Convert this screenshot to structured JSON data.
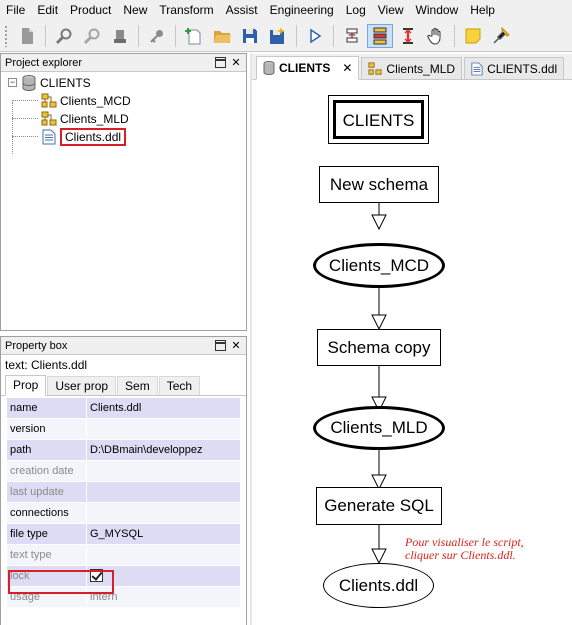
{
  "menubar": {
    "items": [
      "File",
      "Edit",
      "Product",
      "New",
      "Transform",
      "Assist",
      "Engineering",
      "Log",
      "View",
      "Window",
      "Help"
    ]
  },
  "toolbar": {
    "buttons": [
      "document-icon",
      "search-icon",
      "search-grey-icon",
      "stamp-icon",
      "key-icon",
      "new-project-icon",
      "open-folder-icon",
      "save-icon",
      "save-as-icon",
      "run-icon",
      "collapse-icon",
      "tree-icon",
      "split-icon",
      "hand-icon",
      "note-icon",
      "pin-icon"
    ]
  },
  "project_explorer": {
    "title": "Project explorer",
    "root": "CLIENTS",
    "children": [
      "Clients_MCD",
      "Clients_MLD",
      "Clients.ddl"
    ]
  },
  "property_box": {
    "title": "Property box",
    "subtitle": "text: Clients.ddl",
    "tabs": [
      "Prop",
      "User prop",
      "Sem",
      "Tech"
    ],
    "rows": [
      {
        "key": "name",
        "value": "Clients.ddl"
      },
      {
        "key": "version",
        "value": ""
      },
      {
        "key": "path",
        "value": "D:\\DBmain\\developpez"
      },
      {
        "key": "creation date",
        "value": ""
      },
      {
        "key": "last update",
        "value": ""
      },
      {
        "key": "connections",
        "value": ""
      },
      {
        "key": "file type",
        "value": "G_MYSQL"
      },
      {
        "key": "text type",
        "value": ""
      },
      {
        "key": "lock",
        "value": ""
      },
      {
        "key": "usage",
        "value": "intern"
      }
    ]
  },
  "editor": {
    "tabs": [
      {
        "label": "CLIENTS",
        "close": "✕"
      },
      {
        "label": "Clients_MLD"
      },
      {
        "label": "CLIENTS.ddl"
      }
    ],
    "diagram": {
      "project": "CLIENTS",
      "step1": "New schema",
      "schema1": "Clients_MCD",
      "step2": "Schema copy",
      "schema2": "Clients_MLD",
      "step3": "Generate SQL",
      "output": "Clients.ddl"
    },
    "note_line1": "Pour visualiser le script,",
    "note_line2": "cliquer sur Clients.ddl."
  }
}
